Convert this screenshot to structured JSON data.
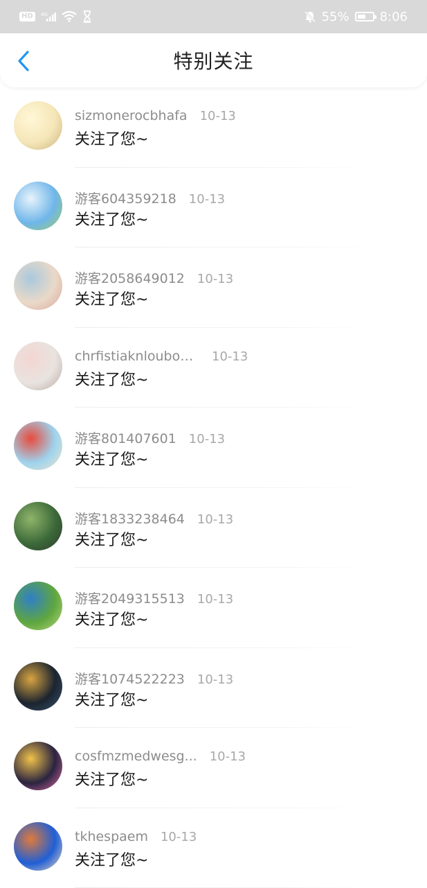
{
  "status_bar": {
    "battery_percent": "55%",
    "time": "8:06",
    "hd_label": "HD",
    "network_label": "4G",
    "battery_level": 0.55
  },
  "header": {
    "title": "特别关注"
  },
  "items": [
    {
      "name": "sizmonerocbhafa",
      "date": "10-13",
      "message": "关注了您~",
      "avatar_colors": [
        "#f5e6b8",
        "#fff7d6",
        "#c9b27a"
      ]
    },
    {
      "name": "游客604359218",
      "date": "10-13",
      "message": "关注了您~",
      "avatar_colors": [
        "#6fb6ea",
        "#e8f3fb",
        "#9ccc6a"
      ]
    },
    {
      "name": "游客2058649012",
      "date": "10-13",
      "message": "关注了您~",
      "avatar_colors": [
        "#ead9c8",
        "#a9c9dd",
        "#d9a79a"
      ]
    },
    {
      "name": "chrfistiaknloubou...",
      "date": "10-13",
      "message": "关注了您~",
      "avatar_colors": [
        "#e9e3df",
        "#f3d6d2",
        "#b9aaa4"
      ]
    },
    {
      "name": "游客801407601",
      "date": "10-13",
      "message": "关注了您~",
      "avatar_colors": [
        "#9ed3ee",
        "#e84b3c",
        "#f2e6c9"
      ]
    },
    {
      "name": "游客1833238464",
      "date": "10-13",
      "message": "关注了您~",
      "avatar_colors": [
        "#3d6a3a",
        "#8fb46a",
        "#2a3b2a"
      ]
    },
    {
      "name": "游客2049315513",
      "date": "10-13",
      "message": "关注了您~",
      "avatar_colors": [
        "#5fa63f",
        "#2f7fc8",
        "#b8d97c"
      ]
    },
    {
      "name": "游客1074522223",
      "date": "10-13",
      "message": "关注了您~",
      "avatar_colors": [
        "#1b2430",
        "#d9a441",
        "#3a5570"
      ]
    },
    {
      "name": "cosfmzmedwesg...",
      "date": "10-13",
      "message": "关注了您~",
      "avatar_colors": [
        "#2a2440",
        "#f1c24a",
        "#e06aa6"
      ]
    },
    {
      "name": "tkhespaem",
      "date": "10-13",
      "message": "关注了您~",
      "avatar_colors": [
        "#1f5fd6",
        "#e07a3a",
        "#f0d9c2"
      ]
    }
  ]
}
